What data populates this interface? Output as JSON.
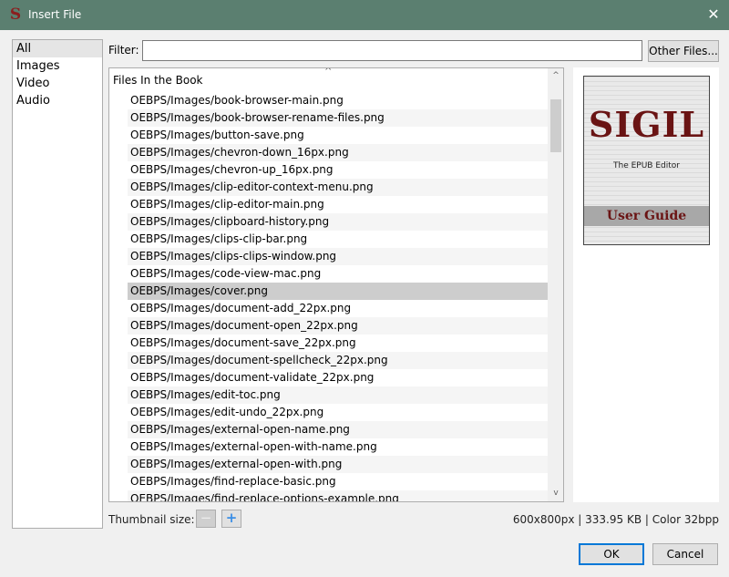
{
  "window": {
    "title": "Insert File",
    "app_icon_glyph": "S",
    "close_glyph": "✕"
  },
  "type_list": {
    "items": [
      "All",
      "Images",
      "Video",
      "Audio"
    ],
    "selected": "All"
  },
  "filter": {
    "label": "Filter:",
    "value": "",
    "other_files_label": "Other Files..."
  },
  "file_tree": {
    "header": "Files In the Book",
    "sort_glyph": "^",
    "files": [
      "OEBPS/Images/book-browser-main.png",
      "OEBPS/Images/book-browser-rename-files.png",
      "OEBPS/Images/button-save.png",
      "OEBPS/Images/chevron-down_16px.png",
      "OEBPS/Images/chevron-up_16px.png",
      "OEBPS/Images/clip-editor-context-menu.png",
      "OEBPS/Images/clip-editor-main.png",
      "OEBPS/Images/clipboard-history.png",
      "OEBPS/Images/clips-clip-bar.png",
      "OEBPS/Images/clips-clips-window.png",
      "OEBPS/Images/code-view-mac.png",
      "OEBPS/Images/cover.png",
      "OEBPS/Images/document-add_22px.png",
      "OEBPS/Images/document-open_22px.png",
      "OEBPS/Images/document-save_22px.png",
      "OEBPS/Images/document-spellcheck_22px.png",
      "OEBPS/Images/document-validate_22px.png",
      "OEBPS/Images/edit-toc.png",
      "OEBPS/Images/edit-undo_22px.png",
      "OEBPS/Images/external-open-name.png",
      "OEBPS/Images/external-open-with-name.png",
      "OEBPS/Images/external-open-with.png",
      "OEBPS/Images/find-replace-basic.png",
      "OEBPS/Images/find-replace-options-example.png"
    ],
    "selected_index": 11,
    "scroll_up_glyph": "^",
    "scroll_down_glyph": "v"
  },
  "preview": {
    "logo": "SIGIL",
    "subtitle": "The EPUB Editor",
    "guide": "User Guide"
  },
  "thumbnail": {
    "label": "Thumbnail size:",
    "minus_glyph": "−",
    "plus_glyph": "+"
  },
  "image_info": "600x800px | 333.95 KB | Color 32bpp",
  "buttons": {
    "ok": "OK",
    "cancel": "Cancel"
  },
  "colors": {
    "titlebar": "#5b7f70",
    "selection": "#cdcdcd",
    "focus_border": "#0078d7",
    "logo_red": "#6a1414"
  }
}
